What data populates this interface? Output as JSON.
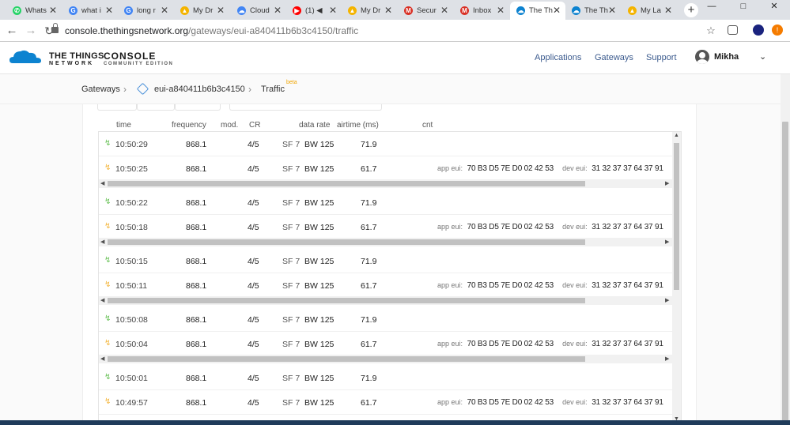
{
  "browser": {
    "tabs": [
      {
        "title": "Whats",
        "icon_color": "#25d366",
        "icon_glyph": "✆"
      },
      {
        "title": "what i",
        "icon_color": "#4285f4",
        "icon_glyph": "G"
      },
      {
        "title": "long r",
        "icon_color": "#4285f4",
        "icon_glyph": "G"
      },
      {
        "title": "My Dr",
        "icon_color": "#f4b400",
        "icon_glyph": "▲"
      },
      {
        "title": "Cloud",
        "icon_color": "#4285f4",
        "icon_glyph": "☁"
      },
      {
        "title": "(1) ◀",
        "icon_color": "#ff0000",
        "icon_glyph": "▶"
      },
      {
        "title": "My Dr",
        "icon_color": "#f4b400",
        "icon_glyph": "▲"
      },
      {
        "title": "Secur",
        "icon_color": "#d93025",
        "icon_glyph": "M"
      },
      {
        "title": "Inbox",
        "icon_color": "#d93025",
        "icon_glyph": "M"
      },
      {
        "title": "The Th",
        "icon_color": "#0d83d0",
        "icon_glyph": "☁"
      },
      {
        "title": "The Th",
        "icon_color": "#0d83d0",
        "icon_glyph": "☁"
      },
      {
        "title": "My La",
        "icon_color": "#f4b400",
        "icon_glyph": "▲"
      }
    ],
    "close_glyph": "✕",
    "newtab_glyph": "+",
    "url_host": "console.thethingsnetwork.org",
    "url_path": "/gateways/eui-a840411b6b3c4150/traffic"
  },
  "header": {
    "logo_line1": "THE THINGS",
    "logo_line2": "NETWORK",
    "console": "CONSOLE",
    "edition": "COMMUNITY EDITION",
    "nav": [
      "Applications",
      "Gateways",
      "Support"
    ],
    "username": "Mikha"
  },
  "breadcrumb": {
    "gateways": "Gateways",
    "gateway_id": "eui-a840411b6b3c4150",
    "traffic": "Traffic",
    "badge": "beta"
  },
  "table": {
    "columns": [
      "time",
      "frequency",
      "mod.",
      "CR",
      "data rate",
      "airtime (ms)",
      "cnt"
    ],
    "app_eui_label": "app eui:",
    "dev_eui_label": "dev eui:",
    "rows": [
      {
        "dir": "up",
        "time": "10:50:29",
        "freq": "868.1",
        "cr": "4/5",
        "sf": "SF 7",
        "bw": "BW 125",
        "air": "71.9"
      },
      {
        "dir": "down",
        "time": "10:50:25",
        "freq": "868.1",
        "cr": "4/5",
        "sf": "SF 7",
        "bw": "BW 125",
        "air": "61.7",
        "app_eui": "70 B3 D5 7E D0 02 42 53",
        "dev_eui": "31 32 37 37 64 37 91"
      },
      {
        "dir": "up",
        "time": "10:50:22",
        "freq": "868.1",
        "cr": "4/5",
        "sf": "SF 7",
        "bw": "BW 125",
        "air": "71.9"
      },
      {
        "dir": "down",
        "time": "10:50:18",
        "freq": "868.1",
        "cr": "4/5",
        "sf": "SF 7",
        "bw": "BW 125",
        "air": "61.7",
        "app_eui": "70 B3 D5 7E D0 02 42 53",
        "dev_eui": "31 32 37 37 64 37 91"
      },
      {
        "dir": "up",
        "time": "10:50:15",
        "freq": "868.1",
        "cr": "4/5",
        "sf": "SF 7",
        "bw": "BW 125",
        "air": "71.9"
      },
      {
        "dir": "down",
        "time": "10:50:11",
        "freq": "868.1",
        "cr": "4/5",
        "sf": "SF 7",
        "bw": "BW 125",
        "air": "61.7",
        "app_eui": "70 B3 D5 7E D0 02 42 53",
        "dev_eui": "31 32 37 37 64 37 91"
      },
      {
        "dir": "up",
        "time": "10:50:08",
        "freq": "868.1",
        "cr": "4/5",
        "sf": "SF 7",
        "bw": "BW 125",
        "air": "71.9"
      },
      {
        "dir": "down",
        "time": "10:50:04",
        "freq": "868.1",
        "cr": "4/5",
        "sf": "SF 7",
        "bw": "BW 125",
        "air": "61.7",
        "app_eui": "70 B3 D5 7E D0 02 42 53",
        "dev_eui": "31 32 37 37 64 37 91"
      },
      {
        "dir": "up",
        "time": "10:50:01",
        "freq": "868.1",
        "cr": "4/5",
        "sf": "SF 7",
        "bw": "BW 125",
        "air": "71.9"
      },
      {
        "dir": "down",
        "time": "10:49:57",
        "freq": "868.1",
        "cr": "4/5",
        "sf": "SF 7",
        "bw": "BW 125",
        "air": "61.7",
        "app_eui": "70 B3 D5 7E D0 02 42 53",
        "dev_eui": "31 32 37 37 64 37 91"
      }
    ]
  },
  "colors": {
    "brand": "#0d83d0",
    "uplink": "#6ac259",
    "downlink": "#f4b740"
  }
}
